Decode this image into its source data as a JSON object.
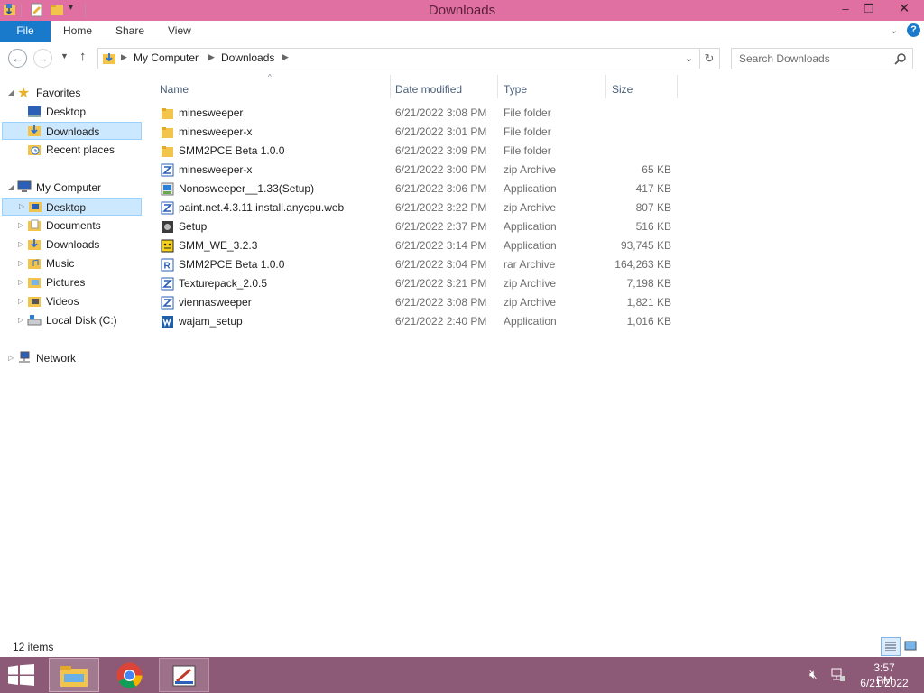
{
  "window": {
    "title": "Downloads"
  },
  "ribbon": {
    "tabs": {
      "file": "File",
      "home": "Home",
      "share": "Share",
      "view": "View"
    }
  },
  "address": {
    "crumbs": [
      "My Computer",
      "Downloads"
    ],
    "search_placeholder": "Search Downloads"
  },
  "nav": {
    "favorites": "Favorites",
    "fav_items": [
      "Desktop",
      "Downloads",
      "Recent places"
    ],
    "computer": "My Computer",
    "computer_items": [
      "Desktop",
      "Documents",
      "Downloads",
      "Music",
      "Pictures",
      "Videos",
      "Local Disk (C:)"
    ],
    "network": "Network"
  },
  "columns": {
    "name": "Name",
    "date": "Date modified",
    "type": "Type",
    "size": "Size"
  },
  "files": [
    {
      "name": "minesweeper",
      "date": "6/21/2022 3:08 PM",
      "type": "File folder",
      "size": "",
      "icon": "folder-icon"
    },
    {
      "name": "minesweeper-x",
      "date": "6/21/2022 3:01 PM",
      "type": "File folder",
      "size": "",
      "icon": "folder-icon"
    },
    {
      "name": "SMM2PCE Beta 1.0.0",
      "date": "6/21/2022 3:09 PM",
      "type": "File folder",
      "size": "",
      "icon": "folder-icon"
    },
    {
      "name": "minesweeper-x",
      "date": "6/21/2022 3:00 PM",
      "type": "zip Archive",
      "size": "65 KB",
      "icon": "zip-archive-icon"
    },
    {
      "name": "Nonosweeper__1.33(Setup)",
      "date": "6/21/2022 3:06 PM",
      "type": "Application",
      "size": "417 KB",
      "icon": "installer-icon"
    },
    {
      "name": "paint.net.4.3.11.install.anycpu.web",
      "date": "6/21/2022 3:22 PM",
      "type": "zip Archive",
      "size": "807 KB",
      "icon": "zip-archive-icon"
    },
    {
      "name": "Setup",
      "date": "6/21/2022 2:37 PM",
      "type": "Application",
      "size": "516 KB",
      "icon": "setup-icon"
    },
    {
      "name": "SMM_WE_3.2.3",
      "date": "6/21/2022 3:14 PM",
      "type": "Application",
      "size": "93,745 KB",
      "icon": "smm-app-icon"
    },
    {
      "name": "SMM2PCE Beta 1.0.0",
      "date": "6/21/2022 3:04 PM",
      "type": "rar Archive",
      "size": "164,263 KB",
      "icon": "rar-archive-icon"
    },
    {
      "name": "Texturepack_2.0.5",
      "date": "6/21/2022 3:21 PM",
      "type": "zip Archive",
      "size": "7,198 KB",
      "icon": "zip-archive-icon"
    },
    {
      "name": "viennasweeper",
      "date": "6/21/2022 3:08 PM",
      "type": "zip Archive",
      "size": "1,821 KB",
      "icon": "zip-archive-icon"
    },
    {
      "name": "wajam_setup",
      "date": "6/21/2022 2:40 PM",
      "type": "Application",
      "size": "1,016 KB",
      "icon": "wajam-icon"
    }
  ],
  "status": {
    "count": "12 items"
  },
  "taskbar": {
    "time": "3:57 PM",
    "date": "6/21/2022"
  },
  "colors": {
    "titlebar": "#e06fa2",
    "file_tab": "#1979ca",
    "taskbar": "#8c5a76",
    "selection": "#cce8ff"
  }
}
